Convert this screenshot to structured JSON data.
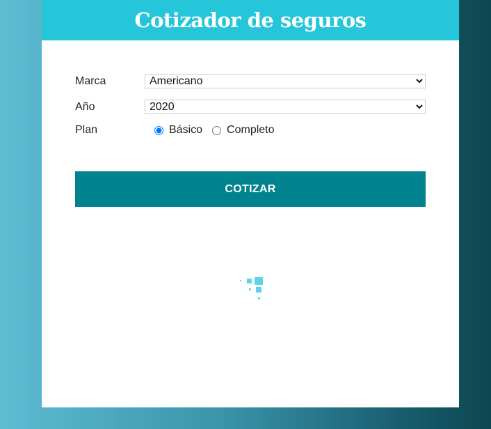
{
  "header": {
    "title": "Cotizador de seguros"
  },
  "form": {
    "marca": {
      "label": "Marca",
      "selected": "Americano"
    },
    "anio": {
      "label": "Año",
      "selected": "2020"
    },
    "plan": {
      "label": "Plan",
      "options": [
        {
          "label": "Básico",
          "checked": true
        },
        {
          "label": "Completo",
          "checked": false
        }
      ]
    },
    "submit_label": "COTIZAR"
  },
  "colors": {
    "header_bg": "#26c6da",
    "button_bg": "#00838f",
    "spinner": "#5fd3e6"
  },
  "spinner": {
    "icon": "loading-spinner-icon"
  }
}
